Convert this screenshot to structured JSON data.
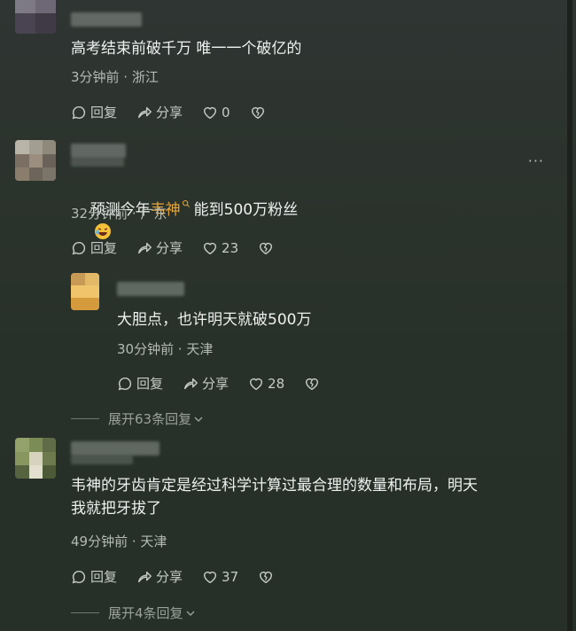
{
  "comments": [
    {
      "text": "高考结束前破千万 唯一一个破亿的",
      "meta": "3分钟前 · 浙江",
      "reply": "回复",
      "share": "分享",
      "likes": "0"
    },
    {
      "text_pre": "预测今年",
      "text_tag": "韦神",
      "text_post": "能到500万粉丝",
      "meta": "32分钟前 · 广东",
      "reply": "回复",
      "share": "分享",
      "likes": "23",
      "more": "···"
    },
    {
      "text": "大胆点，也许明天就破500万",
      "meta": "30分钟前 · 天津",
      "reply": "回复",
      "share": "分享",
      "likes": "28"
    },
    {
      "text": "韦神的牙齿肯定是经过科学计算过最合理的数量和布局，明天\n我就把牙拔了",
      "meta": "49分钟前 · 天津",
      "reply": "回复",
      "share": "分享",
      "likes": "37"
    }
  ],
  "expand_1": "展开63条回复",
  "expand_2": "展开4条回复",
  "colors": {
    "background": "#2b322e",
    "highlight": "#e5a63a"
  }
}
